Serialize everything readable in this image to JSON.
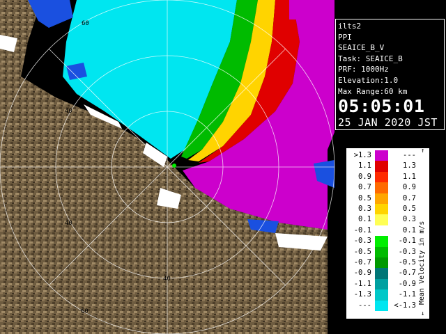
{
  "info": {
    "station": "ilts2",
    "scan_mode": "PPI",
    "product": "SEAICE_B_V",
    "task": "Task: SEAICE_B",
    "prf": "PRF: 1000Hz",
    "elevation": "Elevation:1.0",
    "max_range": "Max Range:60 km",
    "time": "05:05:01",
    "date": "25 JAN 2020 JST"
  },
  "range_rings": {
    "labels": [
      "60",
      "40",
      "40",
      "40",
      "60"
    ]
  },
  "legend": {
    "title": "Mean Velocity in m/s",
    "rows": [
      {
        "lo": ">1.3",
        "hi": "---",
        "color": "#cc00cc"
      },
      {
        "lo": "1.1",
        "hi": "1.3",
        "color": "#e00000"
      },
      {
        "lo": "0.9",
        "hi": "1.1",
        "color": "#ff2a00"
      },
      {
        "lo": "0.7",
        "hi": "0.9",
        "color": "#ff6a00"
      },
      {
        "lo": "0.5",
        "hi": "0.7",
        "color": "#ffa600"
      },
      {
        "lo": "0.3",
        "hi": "0.5",
        "color": "#ffd400"
      },
      {
        "lo": "0.1",
        "hi": "0.3",
        "color": "#ffff55"
      },
      {
        "lo": "-0.1",
        "hi": "0.1",
        "color": "#ffffff"
      },
      {
        "lo": "-0.3",
        "hi": "-0.1",
        "color": "#00ee00"
      },
      {
        "lo": "-0.5",
        "hi": "-0.3",
        "color": "#00bb00"
      },
      {
        "lo": "-0.7",
        "hi": "-0.5",
        "color": "#009900"
      },
      {
        "lo": "-0.9",
        "hi": "-0.7",
        "color": "#007777"
      },
      {
        "lo": "-1.1",
        "hi": "-0.9",
        "color": "#00a0a0"
      },
      {
        "lo": "-1.3",
        "hi": "-1.1",
        "color": "#00c8c8"
      },
      {
        "lo": "---",
        "hi": "<-1.3",
        "color": "#00e6f0"
      }
    ],
    "arrow_up": "↑",
    "arrow_down": "↓"
  },
  "colors": {
    "approaching": "#00e6f0",
    "receding": "#cc00cc",
    "sea_ice_blue": "#1a50e0",
    "terrain": "#6a5a40",
    "ring_line": "#ffffff"
  }
}
